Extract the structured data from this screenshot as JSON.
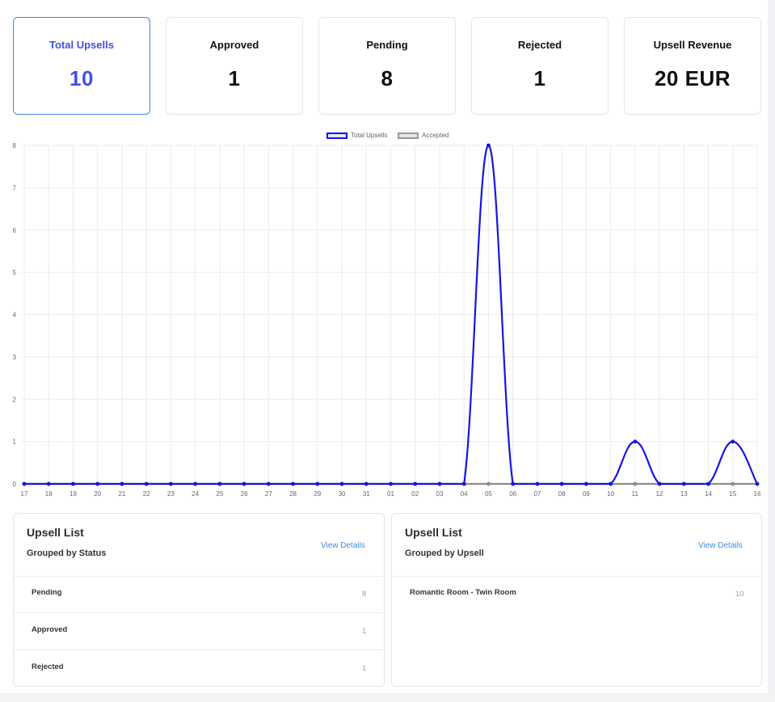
{
  "stats": [
    {
      "label": "Total Upsells",
      "value": "10",
      "active": true
    },
    {
      "label": "Approved",
      "value": "1"
    },
    {
      "label": "Pending",
      "value": "8"
    },
    {
      "label": "Rejected",
      "value": "1"
    },
    {
      "label": "Upsell Revenue",
      "value": "20 EUR"
    }
  ],
  "legend": {
    "total": "Total Upsells",
    "accepted": "Accepted"
  },
  "chart_data": {
    "type": "line",
    "x": [
      "17",
      "18",
      "19",
      "20",
      "21",
      "22",
      "23",
      "24",
      "25",
      "26",
      "27",
      "28",
      "29",
      "30",
      "31",
      "01",
      "02",
      "03",
      "04",
      "05",
      "06",
      "07",
      "08",
      "09",
      "10",
      "11",
      "12",
      "13",
      "14",
      "15",
      "16"
    ],
    "yticks": [
      "0",
      "1",
      "2",
      "3",
      "4",
      "5",
      "6",
      "7",
      "8"
    ],
    "ylim": [
      0,
      8
    ],
    "grid": true,
    "legend_position": "top",
    "series": [
      {
        "name": "Total Upsells",
        "color": "#1515e6",
        "values": [
          0,
          0,
          0,
          0,
          0,
          0,
          0,
          0,
          0,
          0,
          0,
          0,
          0,
          0,
          0,
          0,
          0,
          0,
          0,
          8,
          0,
          0,
          0,
          0,
          0,
          1,
          0,
          0,
          0,
          1,
          0
        ]
      },
      {
        "name": "Accepted",
        "color": "#8c8c8c",
        "values": [
          0,
          0,
          0,
          0,
          0,
          0,
          0,
          0,
          0,
          0,
          0,
          0,
          0,
          0,
          0,
          0,
          0,
          0,
          0,
          0,
          0,
          0,
          0,
          0,
          0,
          0,
          0,
          0,
          0,
          0,
          0
        ]
      }
    ]
  },
  "panels": {
    "status": {
      "title": "Upsell List",
      "subtitle": "Grouped by Status",
      "link": "View Details",
      "rows": [
        {
          "label": "Pending",
          "count": "8"
        },
        {
          "label": "Approved",
          "count": "1"
        },
        {
          "label": "Rejected",
          "count": "1"
        }
      ]
    },
    "upsell": {
      "title": "Upsell List",
      "subtitle": "Grouped by Upsell",
      "link": "View Details",
      "rows": [
        {
          "label": "Romantic Room - Twin Room",
          "count": "10"
        }
      ]
    }
  }
}
